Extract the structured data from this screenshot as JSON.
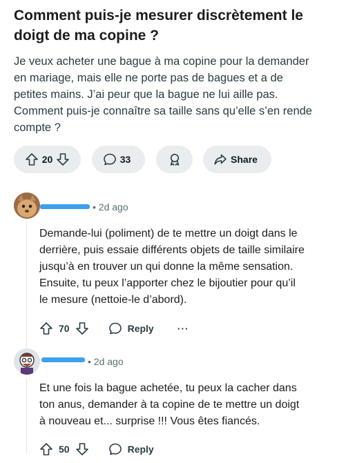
{
  "post": {
    "title_line1": "Comment puis-je mesurer discrètement le",
    "title_line2": "doigt de ma copine ?",
    "body_lines": [
      "Je veux acheter une bague à ma copine pour la demander",
      "en mariage, mais elle ne porte pas de bagues et a de",
      "petites mains. J’ai peur que la bague ne lui aille pas.",
      "Comment puis-je connaître sa taille sans qu’elle s’en rende",
      "compte ?"
    ],
    "upvotes": "20",
    "comments": "33",
    "share_label": "Share"
  },
  "comments": [
    {
      "age": "2d ago",
      "lines": [
        "Demande-lui (poliment) de te mettre un doigt dans le",
        "derrière, puis essaie différents objets de taille similaire",
        "jusqu’à en trouver un qui donne la même sensation.",
        "Ensuite, tu peux l’apporter chez le bijoutier pour qu’il",
        "le mesure (nettoie-le d’abord)."
      ],
      "votes": "70",
      "reply_label": "Reply",
      "more_label": "···"
    },
    {
      "age": "2d ago",
      "lines": [
        "Et une fois la bague achetée, tu peux la cacher dans",
        "ton anus, demander à ta copine de te mettre un doigt",
        "à nouveau et... surprise !!! Vous êtes fiancés."
      ],
      "votes": "50",
      "reply_label": "Reply"
    }
  ],
  "colors": {
    "pill_bg": "#eaedef",
    "redaction": "#3ea0ec",
    "meta_text": "#576f76"
  },
  "icons": [
    "upvote-icon",
    "downvote-icon",
    "comment-bubble-icon",
    "award-icon",
    "share-arrow-icon",
    "reply-bubble-icon",
    "more-icon"
  ]
}
